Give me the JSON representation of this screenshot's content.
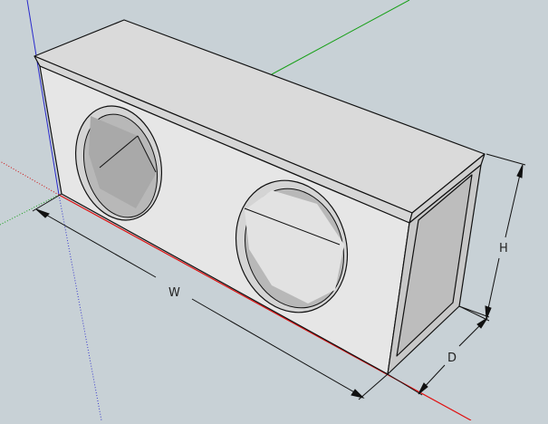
{
  "scene": {
    "background": "#c8d1d6",
    "model": "dual-speaker-box",
    "axes": {
      "x_color": "#e01010",
      "y_color": "#10a010",
      "z_color": "#2020c0"
    },
    "face_colors": {
      "front": "#e5e5e5",
      "top": "#d9d9d9",
      "side_panel": "#bfbfbf",
      "hole_interior": "#a9a9a9"
    }
  },
  "dimensions": {
    "width_label": "W",
    "height_label": "H",
    "depth_label": "D"
  }
}
